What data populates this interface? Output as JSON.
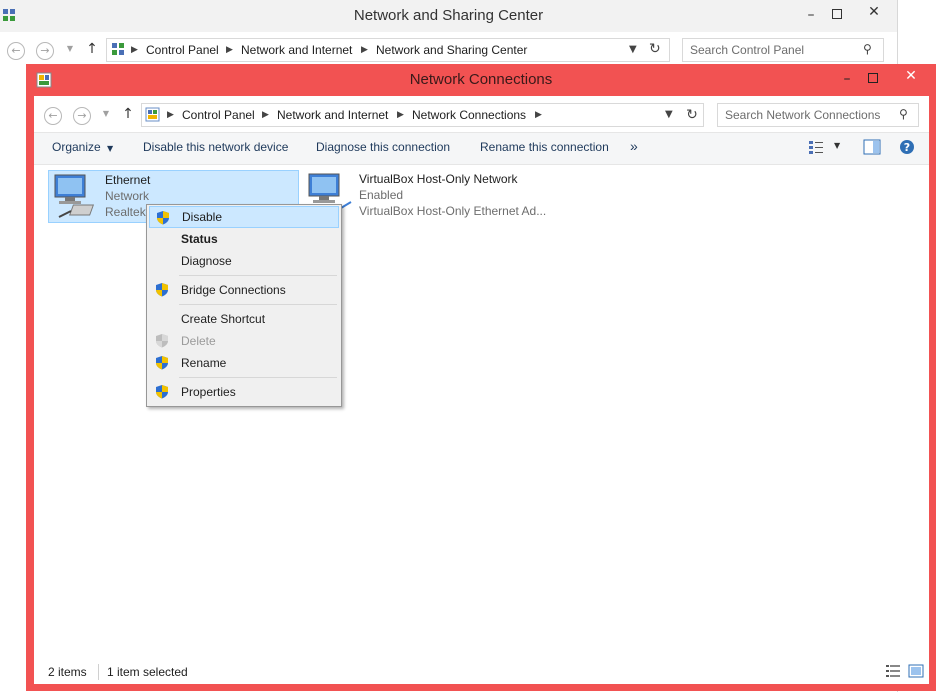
{
  "bg_window": {
    "title": "Network and Sharing Center",
    "address": [
      "Control Panel",
      "Network and Internet",
      "Network and Sharing Center"
    ],
    "search_placeholder": "Search Control Panel"
  },
  "fg_window": {
    "title": "Network Connections",
    "address": [
      "Control Panel",
      "Network and Internet",
      "Network Connections"
    ],
    "search_placeholder": "Search Network Connections",
    "commands": {
      "organize": "Organize",
      "disable": "Disable this network device",
      "diagnose": "Diagnose this connection",
      "rename": "Rename this connection",
      "more": "»"
    },
    "items": [
      {
        "name": "Ethernet",
        "line2": "Network",
        "line3": "Realtek"
      },
      {
        "name": "VirtualBox Host-Only Network",
        "line2": "Enabled",
        "line3": "VirtualBox Host-Only Ethernet Ad..."
      }
    ],
    "status": {
      "count": "2 items",
      "selected": "1 item selected"
    }
  },
  "context_menu": {
    "items": [
      {
        "label": "Disable",
        "shield": true,
        "highlighted": true
      },
      {
        "label": "Status",
        "bold": true
      },
      {
        "label": "Diagnose"
      },
      {
        "label": "Bridge Connections",
        "shield": true
      },
      {
        "label": "Create Shortcut"
      },
      {
        "label": "Delete",
        "shield": true,
        "disabled": true
      },
      {
        "label": "Rename",
        "shield": true
      },
      {
        "label": "Properties",
        "shield": true
      }
    ]
  },
  "colors": {
    "fg_frame": "#f25252",
    "selection": "#cce8ff",
    "command_text": "#1e395b"
  }
}
